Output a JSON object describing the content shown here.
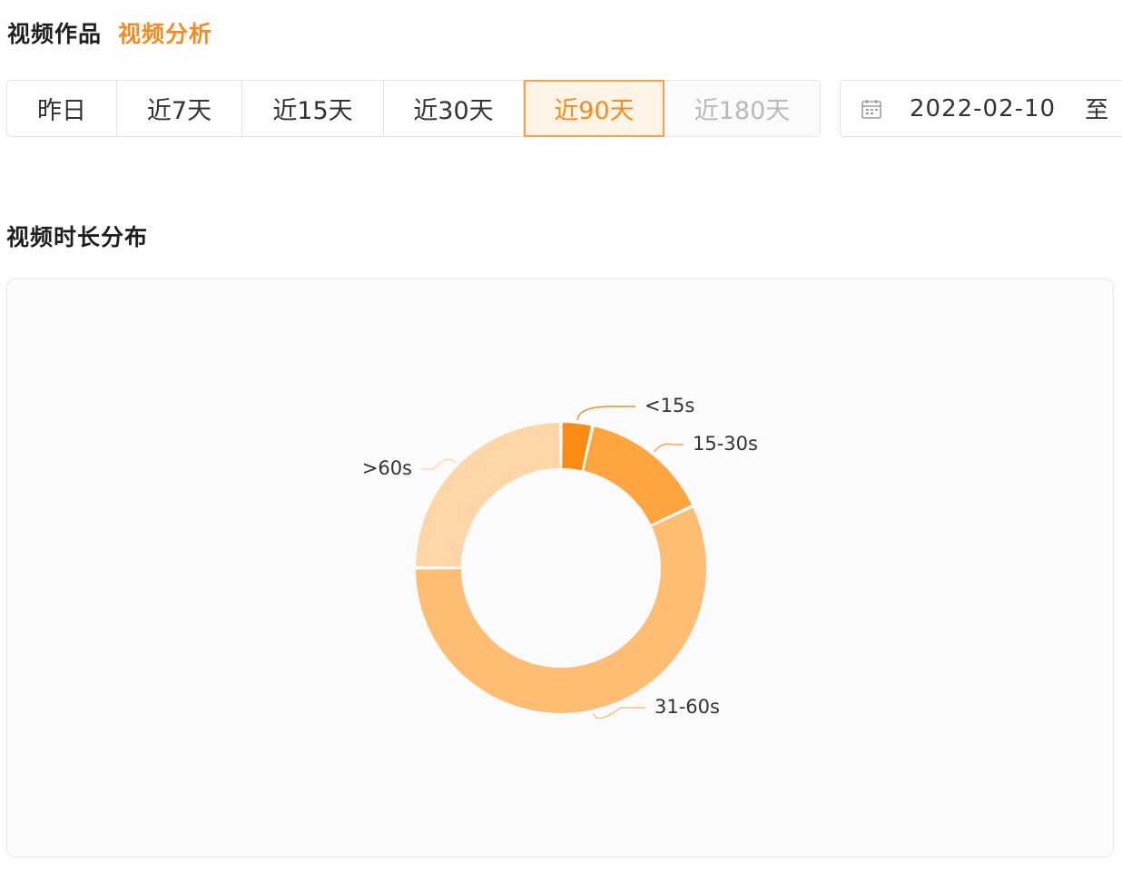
{
  "header": {
    "tabs": [
      {
        "label": "视频作品",
        "active": false
      },
      {
        "label": "视频分析",
        "active": true
      }
    ]
  },
  "filters": {
    "ranges": [
      {
        "label": "昨日",
        "state": "normal"
      },
      {
        "label": "近7天",
        "state": "normal"
      },
      {
        "label": "近15天",
        "state": "normal"
      },
      {
        "label": "近30天",
        "state": "normal"
      },
      {
        "label": "近90天",
        "state": "selected"
      },
      {
        "label": "近180天",
        "state": "disabled"
      }
    ],
    "date_range": {
      "start": "2022-02-10",
      "separator": "至"
    }
  },
  "section": {
    "title": "视频时长分布"
  },
  "colors": {
    "accent": "#f58a1f",
    "slice_colors": [
      "#fa8c16",
      "#ffa53f",
      "#ffbd74",
      "#fed6a8"
    ]
  },
  "chart_data": {
    "type": "pie",
    "donut": true,
    "categories": [
      "<15s",
      "15-30s",
      "31-60s",
      ">60s"
    ],
    "values": [
      3.5,
      14.5,
      57,
      25
    ],
    "label_placement": "outside"
  }
}
